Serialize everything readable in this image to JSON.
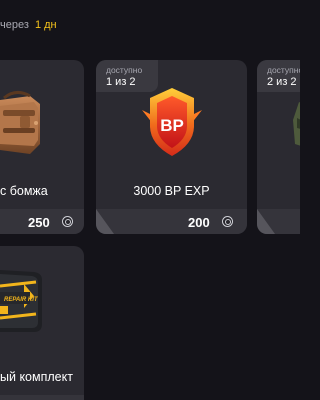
{
  "header": {
    "refresh_prefix": "через",
    "refresh_value": "1 дн"
  },
  "cards": [
    {
      "name": "с бомжа",
      "price": "250",
      "icon": "duffel-bag-icon"
    },
    {
      "availability_label": "доступно",
      "availability_count": "1 из 2",
      "name": "3000 BP EXP",
      "price": "200",
      "icon": "bp-badge-icon",
      "badge_text": "BP"
    },
    {
      "availability_label": "доступно",
      "availability_count": "2 из 2",
      "icon": "partial-item-icon"
    },
    {
      "name": "ый комплект",
      "icon": "repair-kit-icon",
      "kit_text": "REPAIR KIT"
    }
  ],
  "colors": {
    "background": "#141319",
    "card": "#2b2a31",
    "card_footer": "#35343b",
    "accent": "#f4c21b",
    "muted_text": "#a9a9b2"
  }
}
